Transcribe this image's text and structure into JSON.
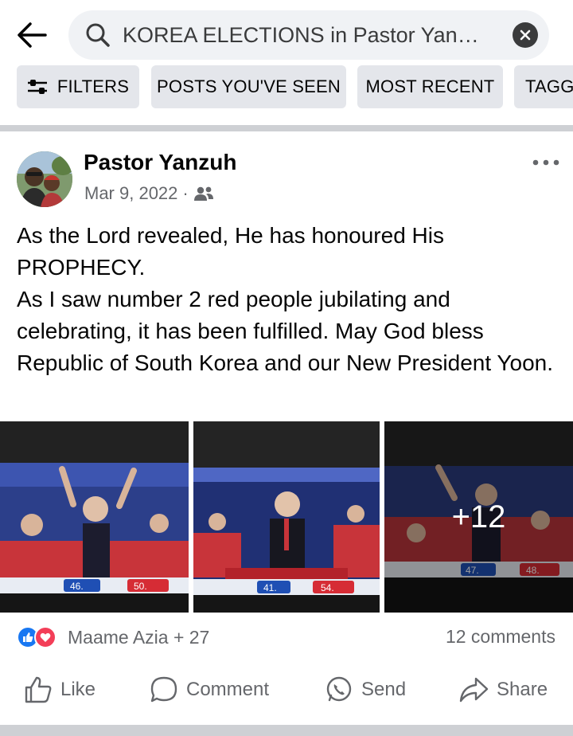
{
  "search": {
    "query": "KOREA ELECTIONS in Pastor Yanzuh",
    "back_icon": "arrow-left-icon",
    "clear_icon": "close-circle-icon"
  },
  "filters": [
    {
      "label": "FILTERS",
      "icon": "sliders-icon"
    },
    {
      "label": "POSTS YOU'VE SEEN"
    },
    {
      "label": "MOST RECENT"
    },
    {
      "label": "TAGG"
    }
  ],
  "post": {
    "author": "Pastor Yanzuh",
    "date": "Mar 9, 2022",
    "separator": "·",
    "audience_icon": "friends-icon",
    "text": [
      "As the Lord revealed, He has honoured His PROPHECY.",
      "As I saw number 2 red people jubilating and celebrating, it has been fulfilled. May God bless Republic of South Korea and our New President Yoon."
    ],
    "photos": [
      {
        "overlay": "",
        "bar_left": "46.",
        "bar_right": "50."
      },
      {
        "overlay": "",
        "bar_left": "41.",
        "bar_right": "54."
      },
      {
        "overlay": "+12",
        "bar_left": "47.",
        "bar_right": "48."
      }
    ],
    "reactions_text": "Maame Azia + 27",
    "comments_text": "12 comments"
  },
  "actions": {
    "like": "Like",
    "comment": "Comment",
    "send": "Send",
    "share": "Share"
  },
  "colors": {
    "like_blue": "#1877f2",
    "love_red": "#f33e58",
    "secondary_text": "#65676b",
    "chip_bg": "#e4e6eb"
  }
}
